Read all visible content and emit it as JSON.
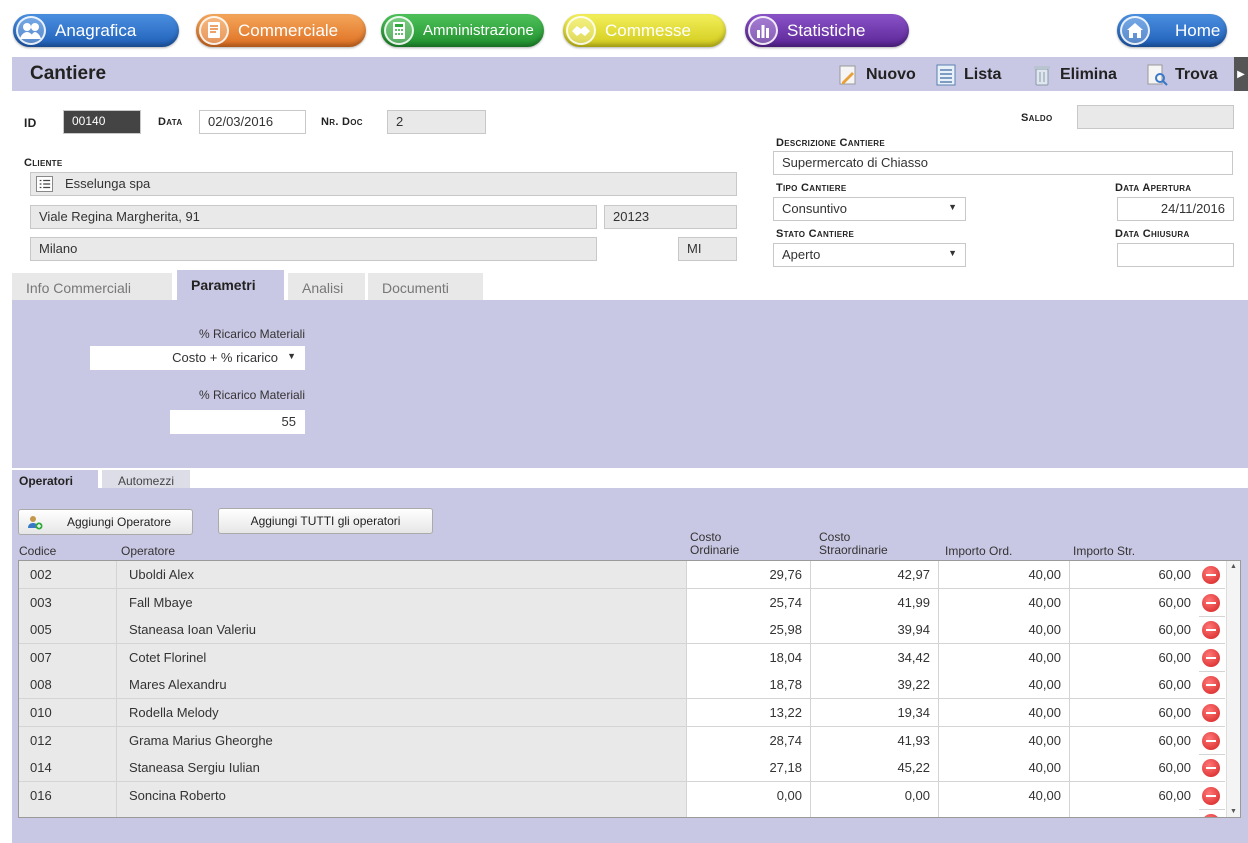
{
  "nav": {
    "anagrafica": "Anagrafica",
    "commerciale": "Commerciale",
    "amministrazione": "Amministrazione",
    "commesse": "Commesse",
    "statistiche": "Statistiche",
    "home": "Home"
  },
  "titlebar": {
    "title": "Cantiere",
    "nuovo": "Nuovo",
    "lista": "Lista",
    "elimina": "Elimina",
    "trova": "Trova"
  },
  "form": {
    "id_label": "ID",
    "id_value": "00140",
    "data_label": "Data",
    "data_value": "02/03/2016",
    "nrdoc_label": "Nr. Doc",
    "nrdoc_value": "2",
    "saldo_label": "Saldo",
    "saldo_value": "",
    "cliente_label": "Cliente",
    "cliente_value": "Esselunga spa",
    "indirizzo": "Viale Regina Margherita, 91",
    "cap": "20123",
    "citta": "Milano",
    "provincia": "MI",
    "descrizione_label": "Descrizione Cantiere",
    "descrizione_value": "Supermercato di Chiasso",
    "tipo_label": "Tipo Cantiere",
    "tipo_value": "Consuntivo",
    "apertura_label": "Data Apertura",
    "apertura_value": "24/11/2016",
    "stato_label": "Stato Cantiere",
    "stato_value": "Aperto",
    "chiusura_label": "Data Chiusura",
    "chiusura_value": ""
  },
  "tabs": [
    "Info Commerciali",
    "Parametri",
    "Analisi",
    "Documenti"
  ],
  "parametri": {
    "ricarico_label_1": "% Ricarico Materiali",
    "ricarico_select": "Costo + % ricarico",
    "ricarico_label_2": "% Ricarico Materiali",
    "ricarico_value": "55"
  },
  "subtabs": [
    "Operatori",
    "Automezzi"
  ],
  "buttons": {
    "aggiungi_operatore": "Aggiungi Operatore",
    "aggiungi_tutti": "Aggiungi TUTTI gli operatori"
  },
  "table": {
    "headers": {
      "codice": "Codice",
      "operatore": "Operatore",
      "costo_ord_1": "Costo",
      "costo_ord_2": "Ordinarie",
      "costo_str_1": "Costo",
      "costo_str_2": "Straordinarie",
      "importo_ord": "Importo Ord.",
      "importo_str": "Importo Str."
    },
    "rows": [
      {
        "codice": "002",
        "operatore": "Uboldi Alex",
        "costo_ord": "29,76",
        "costo_str": "42,97",
        "importo_ord": "40,00",
        "importo_str": "60,00"
      },
      {
        "codice": "003",
        "operatore": "Fall Mbaye",
        "costo_ord": "25,74",
        "costo_str": "41,99",
        "importo_ord": "40,00",
        "importo_str": "60,00"
      },
      {
        "codice": "005",
        "operatore": "Staneasa Ioan Valeriu",
        "costo_ord": "25,98",
        "costo_str": "39,94",
        "importo_ord": "40,00",
        "importo_str": "60,00"
      },
      {
        "codice": "007",
        "operatore": "Cotet  Florinel",
        "costo_ord": "18,04",
        "costo_str": "34,42",
        "importo_ord": "40,00",
        "importo_str": "60,00"
      },
      {
        "codice": "008",
        "operatore": "Mares Alexandru",
        "costo_ord": "18,78",
        "costo_str": "39,22",
        "importo_ord": "40,00",
        "importo_str": "60,00"
      },
      {
        "codice": "010",
        "operatore": "Rodella  Melody",
        "costo_ord": "13,22",
        "costo_str": "19,34",
        "importo_ord": "40,00",
        "importo_str": "60,00"
      },
      {
        "codice": "012",
        "operatore": "Grama Marius Gheorghe",
        "costo_ord": "28,74",
        "costo_str": "41,93",
        "importo_ord": "40,00",
        "importo_str": "60,00"
      },
      {
        "codice": "014",
        "operatore": "Staneasa Sergiu Iulian",
        "costo_ord": "27,18",
        "costo_str": "45,22",
        "importo_ord": "40,00",
        "importo_str": "60,00"
      },
      {
        "codice": "016",
        "operatore": "Soncina  Roberto",
        "costo_ord": "0,00",
        "costo_str": "0,00",
        "importo_ord": "40,00",
        "importo_str": "60,00"
      }
    ]
  },
  "colors": {
    "panel": "#c9c8e4",
    "anagrafica": "#2f74cf",
    "commerciale": "#e8833a",
    "amministrazione": "#2fa83c",
    "commesse": "#e3dd33",
    "statistiche": "#6e35ad",
    "delete": "#d42020"
  },
  "icons": {
    "anagrafica": "people-icon",
    "commerciale": "document-icon",
    "amministrazione": "calculator-icon",
    "commesse": "handshake-icon",
    "statistiche": "bar-chart-icon",
    "home": "house-icon",
    "nuovo": "new-document-icon",
    "lista": "list-icon",
    "elimina": "trash-icon",
    "trova": "search-document-icon"
  }
}
